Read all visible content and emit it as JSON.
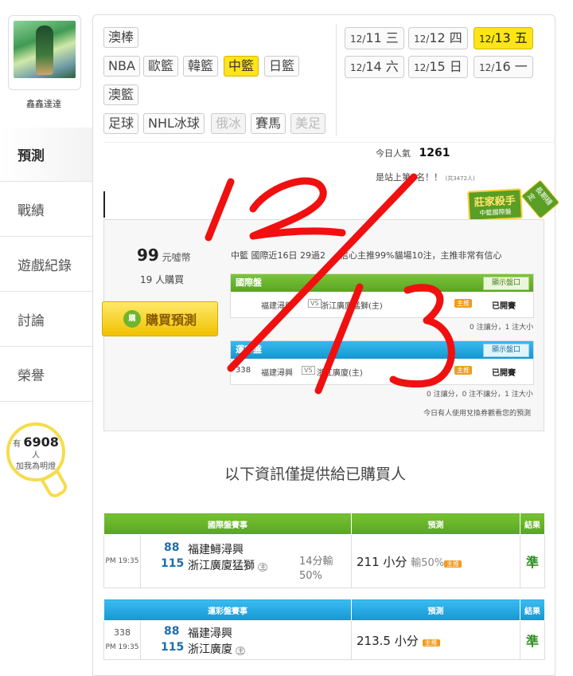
{
  "user": {
    "name": "鑫鑫達達"
  },
  "sidebar": {
    "items": [
      {
        "label": "預測"
      },
      {
        "label": "戰績"
      },
      {
        "label": "遊戲紀錄"
      },
      {
        "label": "討論"
      },
      {
        "label": "榮譽"
      }
    ]
  },
  "fans": {
    "prefix": "有",
    "count": "6908",
    "suffix": "人",
    "label": "加我為明燈"
  },
  "sports": {
    "items": [
      "澳棒",
      "NBA",
      "歐籃",
      "韓籃",
      "中籃",
      "日籃",
      "澳籃",
      "足球",
      "NHL冰球",
      "俄冰",
      "賽馬",
      "美足"
    ],
    "selected": "中籃"
  },
  "dates": [
    {
      "md": "12/",
      "day": "11 三"
    },
    {
      "md": "12/",
      "day": "12 四"
    },
    {
      "md": "12/",
      "day": "13 五"
    },
    {
      "md": "12/",
      "day": "14 六"
    },
    {
      "md": "12/",
      "day": "15 日"
    },
    {
      "md": "12/",
      "day": "16 一"
    }
  ],
  "selected_date": "12/13 五",
  "popularity": {
    "label": "今日人氣",
    "value": "1261",
    "rank_text": "是站上第1名！！",
    "rank_note": "(共3472人)"
  },
  "badge": {
    "title": "莊家殺手",
    "subtitle": "中籃國際盤",
    "tag": "長期穩定"
  },
  "purchase": {
    "price": "99",
    "unit": "元噓幣",
    "buyers": "19 人購買",
    "button": "購買預測",
    "button_icon": "購"
  },
  "description": "中籃 國際近16日 29過2",
  "description_tail": "信心主推99%貓場10注，主推非常有信心",
  "intl_market": {
    "title": "國際盤",
    "show_button": "顯示盤口",
    "home": "福建潯興",
    "away": "浙江廣廈猛獅(主)",
    "vs": "VS",
    "tag": "主推",
    "status": "已開賽",
    "stats": "0 注讓分，1 注大小"
  },
  "lottery_market": {
    "title": "運彩盤",
    "show_button": "顯示盤口",
    "code": "338",
    "home": "福建潯興",
    "away": "浙江廣廈(主)",
    "vs": "VS",
    "tag": "主推",
    "status": "已開賽",
    "stats": "0 注讓分，0 注不讓分，1 注大小"
  },
  "voucher_notice": "今日有人使用兌換券觀看您的預測",
  "purchase_notice": "以下資訊僅提供給已購買人",
  "intl_table": {
    "headers": [
      "國際盤賽事",
      "預測",
      "結果"
    ],
    "time": "PM 19:35",
    "score_home": "88",
    "team_home": "福建鱘潯興",
    "score_away": "115",
    "team_away": "浙江廣廈猛獅",
    "home_tag": "主",
    "handicap": "14分輸",
    "handicap_pct": "50%",
    "prediction": "211 小分",
    "prediction_extra": "輸50%",
    "pred_tag": "主推",
    "result": "準"
  },
  "lottery_table": {
    "headers": [
      "運彩盤賽事",
      "預測",
      "結果"
    ],
    "code": "338",
    "time": "PM 19:35",
    "score_home": "88",
    "team_home": "福建潯興",
    "score_away": "115",
    "team_away": "浙江廣廈",
    "home_tag": "主",
    "prediction": "213.5 小分",
    "pred_tag": "主推",
    "result": "準"
  },
  "colors": {
    "accent_yellow": "#ffe417",
    "header_green": "#5aa523",
    "header_blue": "#1597d3",
    "correct_green": "#2c8f1f",
    "ink_red": "#f01010"
  }
}
